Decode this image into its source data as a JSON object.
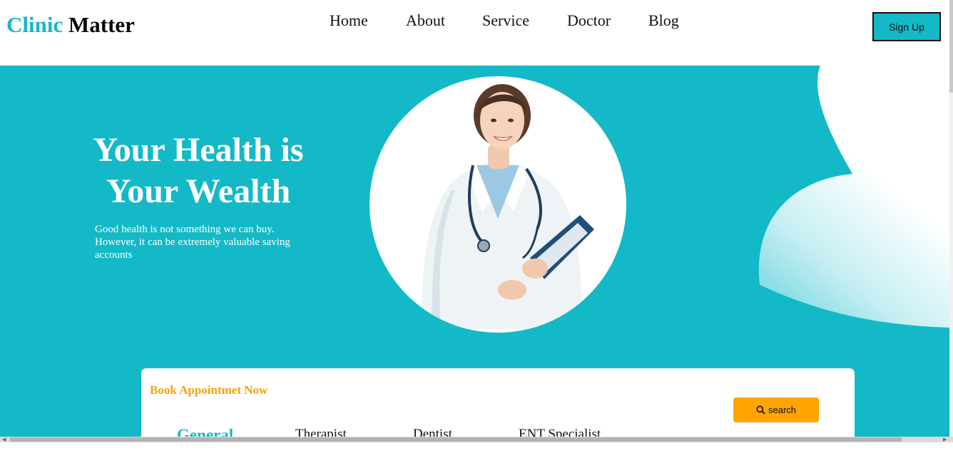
{
  "header": {
    "logo_part1": "Clinic",
    "logo_part2": "Matter",
    "nav": [
      "Home",
      "About",
      "Service",
      "Doctor",
      "Blog"
    ],
    "signup_label": "Sign Up"
  },
  "hero": {
    "title_line1": "Your Health is",
    "title_line2": "Your Wealth",
    "subtitle": "Good health is not something we can buy. However, it can be extremely valuable saving accounts",
    "image": "doctor-portrait"
  },
  "booking": {
    "title": "Book Appointmet Now",
    "search_label": "search",
    "search_icon": "search-icon",
    "categories": [
      "General",
      "Therapist",
      "Dentist",
      "ENT Specialist"
    ],
    "active_category": "General"
  },
  "colors": {
    "brand_teal": "#13b9c7",
    "accent_orange": "#ffa400",
    "title_orange": "#f5a209",
    "text_dark": "#111111"
  }
}
